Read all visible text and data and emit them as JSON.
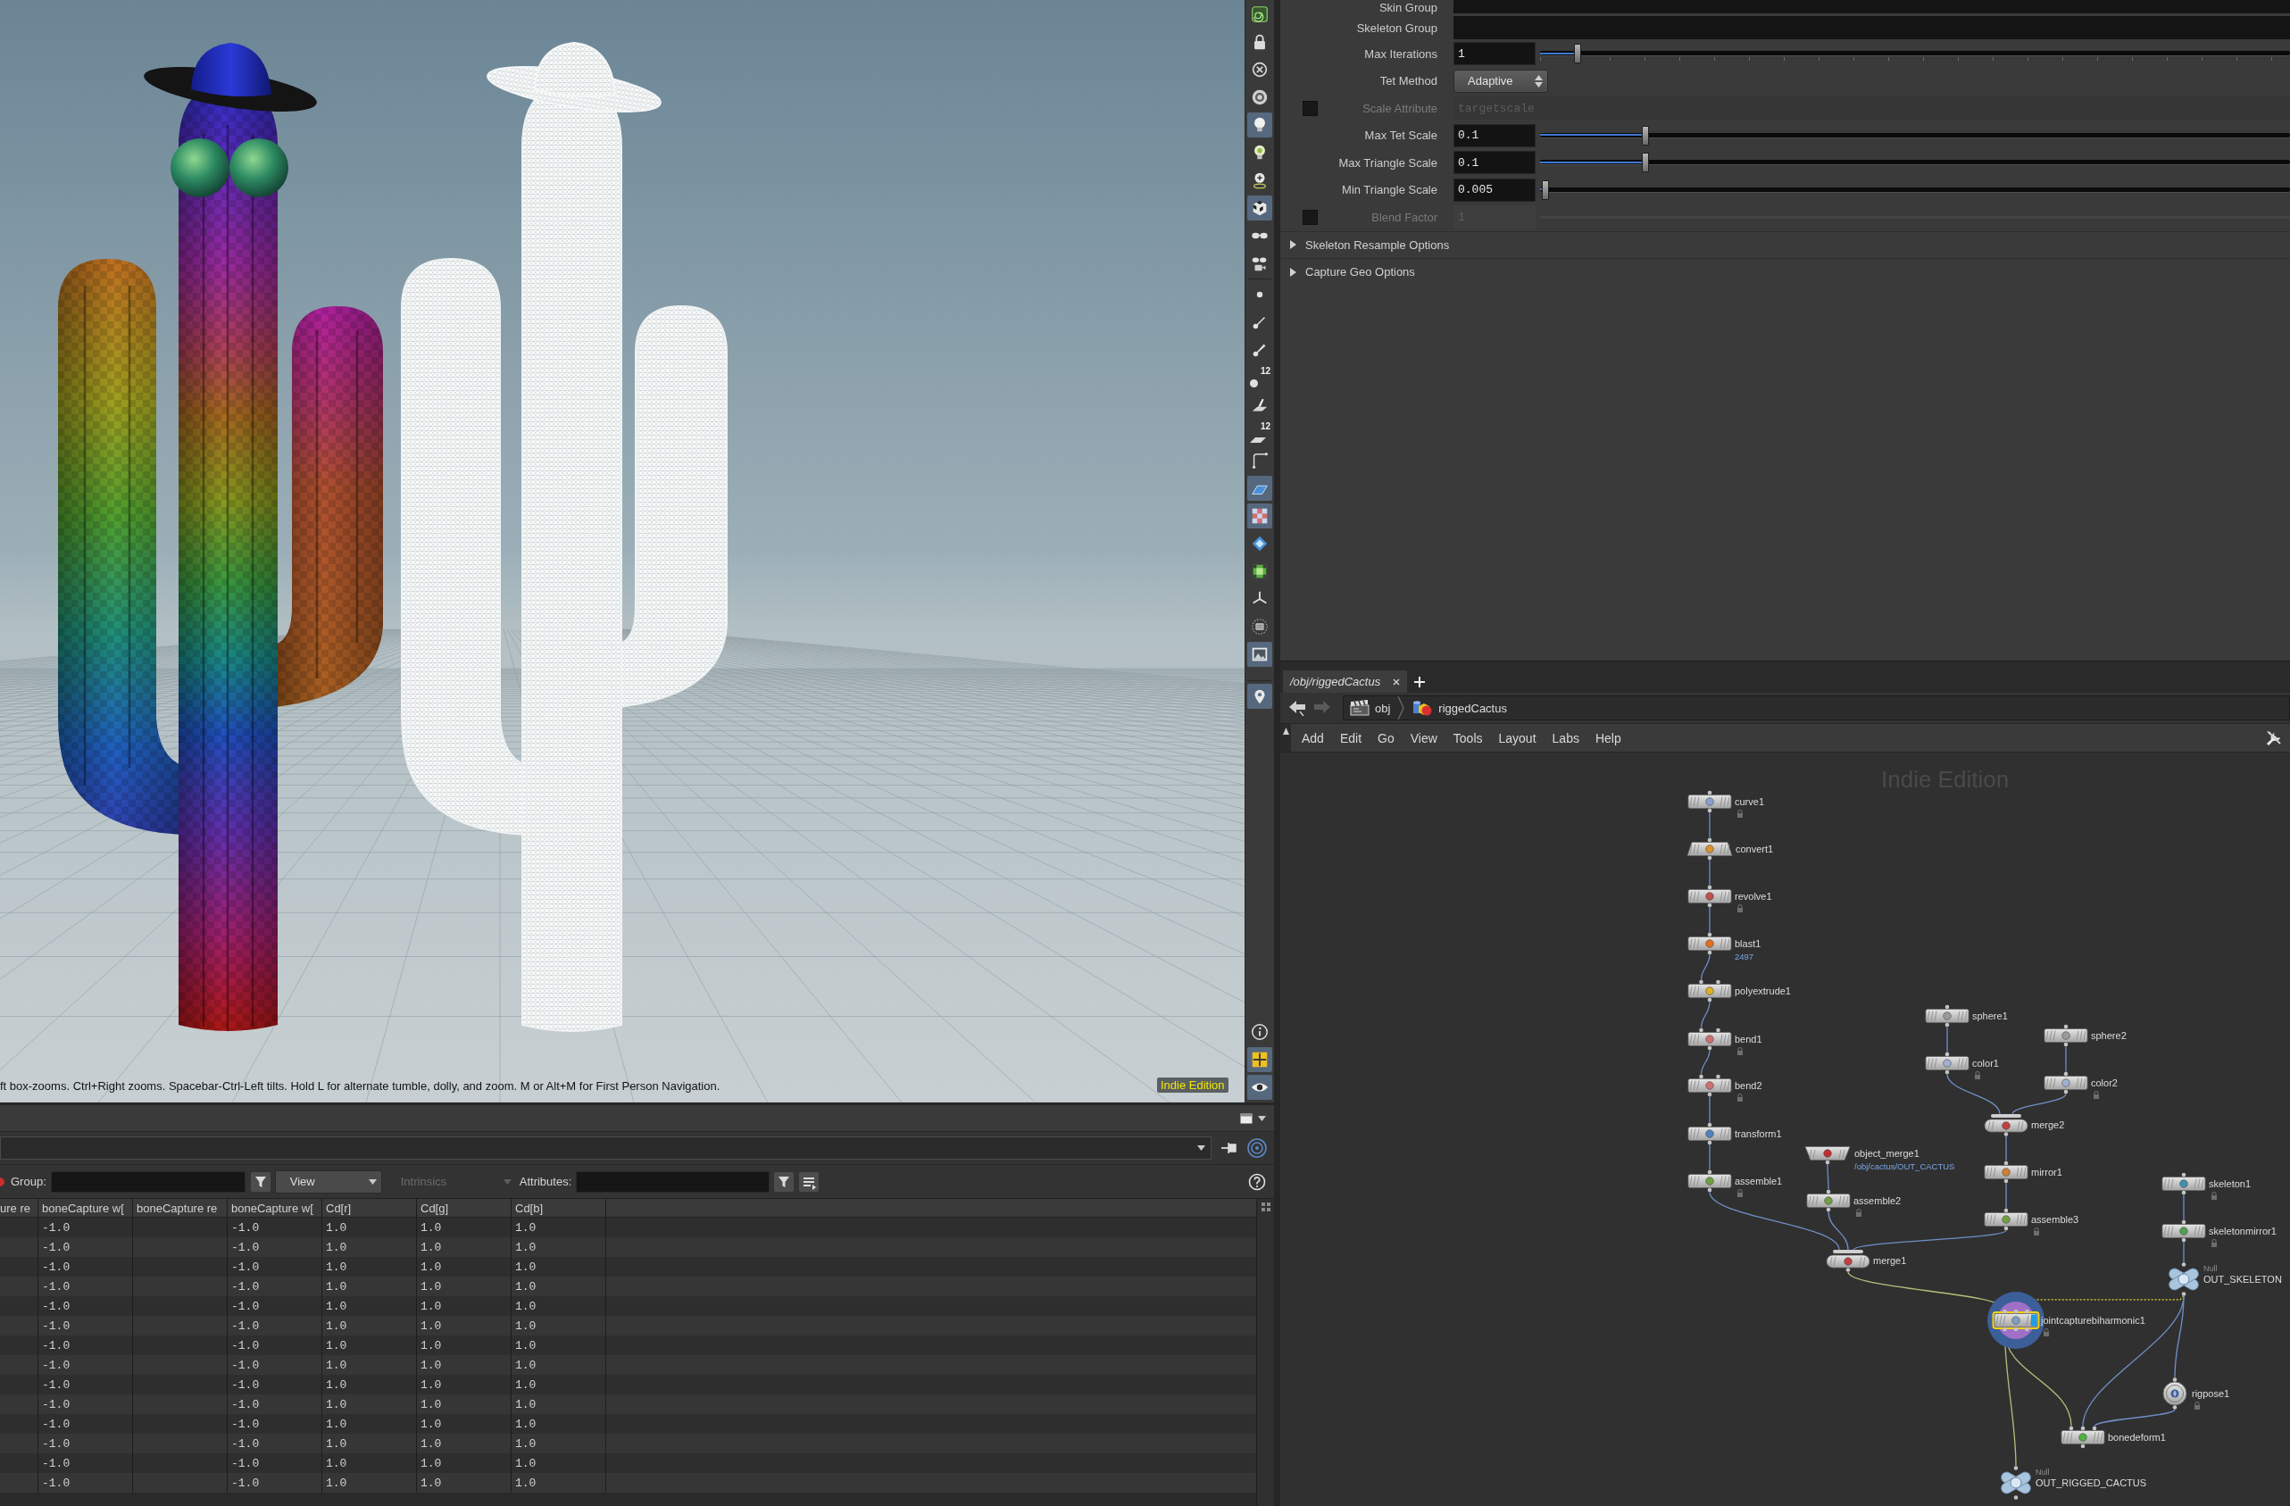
{
  "viewport": {
    "status_hint": "ft box-zooms. Ctrl+Right zooms. Spacebar-Ctrl-Left tilts. Hold L for alternate tumble, dolly, and zoom. M or Alt+M for First Person Navigation.",
    "edition_label": "Indie Edition",
    "toolbar": [
      {
        "on": false
      },
      {
        "on": false
      },
      {
        "on": false
      },
      {
        "on": false
      },
      {
        "on": true
      },
      {
        "on": false
      },
      {
        "on": false
      },
      {
        "on": true
      },
      {
        "on": false
      },
      {
        "on": false
      },
      {
        "on": false
      },
      {
        "on": false
      },
      {
        "on": false
      },
      {
        "on": false,
        "badge": "12"
      },
      {
        "on": false
      },
      {
        "on": false,
        "badge": "12"
      },
      {
        "on": false
      },
      {
        "on": true
      },
      {
        "on": true
      },
      {
        "on": false
      },
      {
        "on": false
      },
      {
        "on": false
      },
      {
        "on": false
      },
      {
        "on": true
      },
      {
        "on": true
      }
    ],
    "toolbar_bottom": [
      {
        "on": false
      },
      {
        "on": true
      },
      {
        "on": true
      }
    ]
  },
  "parameters": [
    {
      "kind": "string",
      "label": "Skin Group",
      "disabled": false
    },
    {
      "kind": "string",
      "label": "Skeleton Group",
      "disabled": false
    },
    {
      "kind": "int_slider",
      "label": "Max Iterations",
      "value": "1",
      "level": 0.05,
      "disabled": false
    },
    {
      "kind": "menu",
      "label": "Tet Method",
      "value": "Adaptive",
      "disabled": false
    },
    {
      "kind": "toggle_string",
      "label": "Scale Attribute",
      "value": "targetscale",
      "checked": false,
      "disabled": true
    },
    {
      "kind": "float_slider",
      "label": "Max Tet Scale",
      "value": "0.1",
      "level": 0.14,
      "disabled": false
    },
    {
      "kind": "float_slider",
      "label": "Max Triangle Scale",
      "value": "0.1",
      "level": 0.14,
      "disabled": false
    },
    {
      "kind": "float_slider",
      "label": "Min Triangle Scale",
      "value": "0.005",
      "level": 0.007,
      "disabled": false
    },
    {
      "kind": "toggle_float",
      "label": "Blend Factor",
      "value": "1",
      "checked": false,
      "disabled": true
    },
    {
      "kind": "folder",
      "label": "Skeleton Resample Options",
      "expanded": false,
      "disabled": false
    },
    {
      "kind": "folder",
      "label": "Capture Geo Options",
      "expanded": false,
      "disabled": false
    }
  ],
  "spreadsheet": {
    "group_label": "Group:",
    "view_menu": "View",
    "intrinsics_menu": {
      "label": "Intrinsics",
      "disabled": true
    },
    "attributes_label": "Attributes:",
    "columns": [
      "ure re",
      "boneCapture w[",
      "boneCapture re",
      "boneCapture w[",
      "Cd[r]",
      "Cd[g]",
      "Cd[b]"
    ],
    "rows": [
      [
        null,
        "-1.0",
        null,
        "-1.0",
        "1.0",
        "1.0",
        "1.0"
      ],
      [
        null,
        "-1.0",
        null,
        "-1.0",
        "1.0",
        "1.0",
        "1.0"
      ],
      [
        null,
        "-1.0",
        null,
        "-1.0",
        "1.0",
        "1.0",
        "1.0"
      ],
      [
        null,
        "-1.0",
        null,
        "-1.0",
        "1.0",
        "1.0",
        "1.0"
      ],
      [
        null,
        "-1.0",
        null,
        "-1.0",
        "1.0",
        "1.0",
        "1.0"
      ],
      [
        null,
        "-1.0",
        null,
        "-1.0",
        "1.0",
        "1.0",
        "1.0"
      ],
      [
        null,
        "-1.0",
        null,
        "-1.0",
        "1.0",
        "1.0",
        "1.0"
      ],
      [
        null,
        "-1.0",
        null,
        "-1.0",
        "1.0",
        "1.0",
        "1.0"
      ],
      [
        null,
        "-1.0",
        null,
        "-1.0",
        "1.0",
        "1.0",
        "1.0"
      ],
      [
        null,
        "-1.0",
        null,
        "-1.0",
        "1.0",
        "1.0",
        "1.0"
      ],
      [
        null,
        "-1.0",
        null,
        "-1.0",
        "1.0",
        "1.0",
        "1.0"
      ],
      [
        null,
        "-1.0",
        null,
        "-1.0",
        "1.0",
        "1.0",
        "1.0"
      ],
      [
        null,
        "-1.0",
        null,
        "-1.0",
        "1.0",
        "1.0",
        "1.0"
      ],
      [
        null,
        "-1.0",
        null,
        "-1.0",
        "1.0",
        "1.0",
        "1.0"
      ]
    ]
  },
  "network": {
    "tabs": [
      {
        "label": "/obj/riggedCactus",
        "selected": true
      }
    ],
    "history_buttons": [
      {
        "disabled": false
      },
      {
        "disabled": true
      }
    ],
    "path": [
      "obj",
      "riggedCactus"
    ],
    "menu": [
      "Add",
      "Edit",
      "Go",
      "View",
      "Tools",
      "Layout",
      "Labs",
      "Help"
    ],
    "edition_label": "Indie Edition",
    "nodes": [
      {
        "kind": "box",
        "label": "curve1",
        "lock_badge": true,
        "selected": false,
        "display": false
      },
      {
        "kind": "trapezoid",
        "label": "convert1",
        "lock_badge": false,
        "selected": false,
        "display": false
      },
      {
        "kind": "box",
        "label": "revolve1",
        "lock_badge": true,
        "selected": false,
        "display": false
      },
      {
        "kind": "box",
        "label": "blast1",
        "sublabel": "2497",
        "lock_badge": false,
        "selected": false,
        "display": false
      },
      {
        "kind": "box",
        "label": "polyextrude1",
        "lock_badge": false,
        "selected": false,
        "display": false
      },
      {
        "kind": "box",
        "label": "bend1",
        "lock_badge": true,
        "selected": false,
        "display": false
      },
      {
        "kind": "box",
        "label": "bend2",
        "lock_badge": true,
        "selected": false,
        "display": false
      },
      {
        "kind": "box",
        "label": "transform1",
        "lock_badge": false,
        "selected": false,
        "display": false
      },
      {
        "kind": "box",
        "label": "assemble1",
        "lock_badge": true,
        "selected": false,
        "display": false
      },
      {
        "kind": "inverted",
        "label": "object_merge1",
        "sublabel": "/obj/cactus/OUT_CACTUS",
        "lock_badge": false,
        "selected": false,
        "display": false
      },
      {
        "kind": "box",
        "label": "assemble2",
        "lock_badge": true,
        "selected": false,
        "display": false
      },
      {
        "kind": "box",
        "label": "sphere1",
        "lock_badge": false,
        "selected": false,
        "display": false
      },
      {
        "kind": "box",
        "label": "color1",
        "lock_badge": true,
        "selected": false,
        "display": false
      },
      {
        "kind": "box",
        "label": "sphere2",
        "lock_badge": false,
        "selected": false,
        "display": false
      },
      {
        "kind": "box",
        "label": "color2",
        "lock_badge": true,
        "selected": false,
        "display": false
      },
      {
        "kind": "merge",
        "label": "merge2",
        "lock_badge": false,
        "selected": false,
        "display": false
      },
      {
        "kind": "box",
        "label": "mirror1",
        "lock_badge": false,
        "selected": false,
        "display": false
      },
      {
        "kind": "box",
        "label": "assemble3",
        "lock_badge": true,
        "selected": false,
        "display": false
      },
      {
        "kind": "merge",
        "label": "merge1",
        "lock_badge": false,
        "selected": false,
        "display": false
      },
      {
        "kind": "box",
        "label": "skeleton1",
        "lock_badge": true,
        "selected": false,
        "display": false
      },
      {
        "kind": "box",
        "label": "skeletonmirror1",
        "lock_badge": true,
        "selected": false,
        "display": false
      },
      {
        "kind": "null",
        "label": "OUT_SKELETON",
        "type_label": "Null",
        "lock_badge": false,
        "selected": false,
        "display": false
      },
      {
        "kind": "box",
        "label": "jointcapturebiharmonic1",
        "lock_badge": true,
        "selected": true,
        "display": true
      },
      {
        "kind": "circle",
        "label": "rigpose1",
        "lock_badge": true,
        "selected": false,
        "display": false
      },
      {
        "kind": "box",
        "label": "bonedeform1",
        "lock_badge": false,
        "selected": false,
        "display": false
      },
      {
        "kind": "null",
        "label": "OUT_RIGGED_CACTUS",
        "type_label": "Null",
        "lock_badge": false,
        "selected": false,
        "display": false
      }
    ]
  }
}
